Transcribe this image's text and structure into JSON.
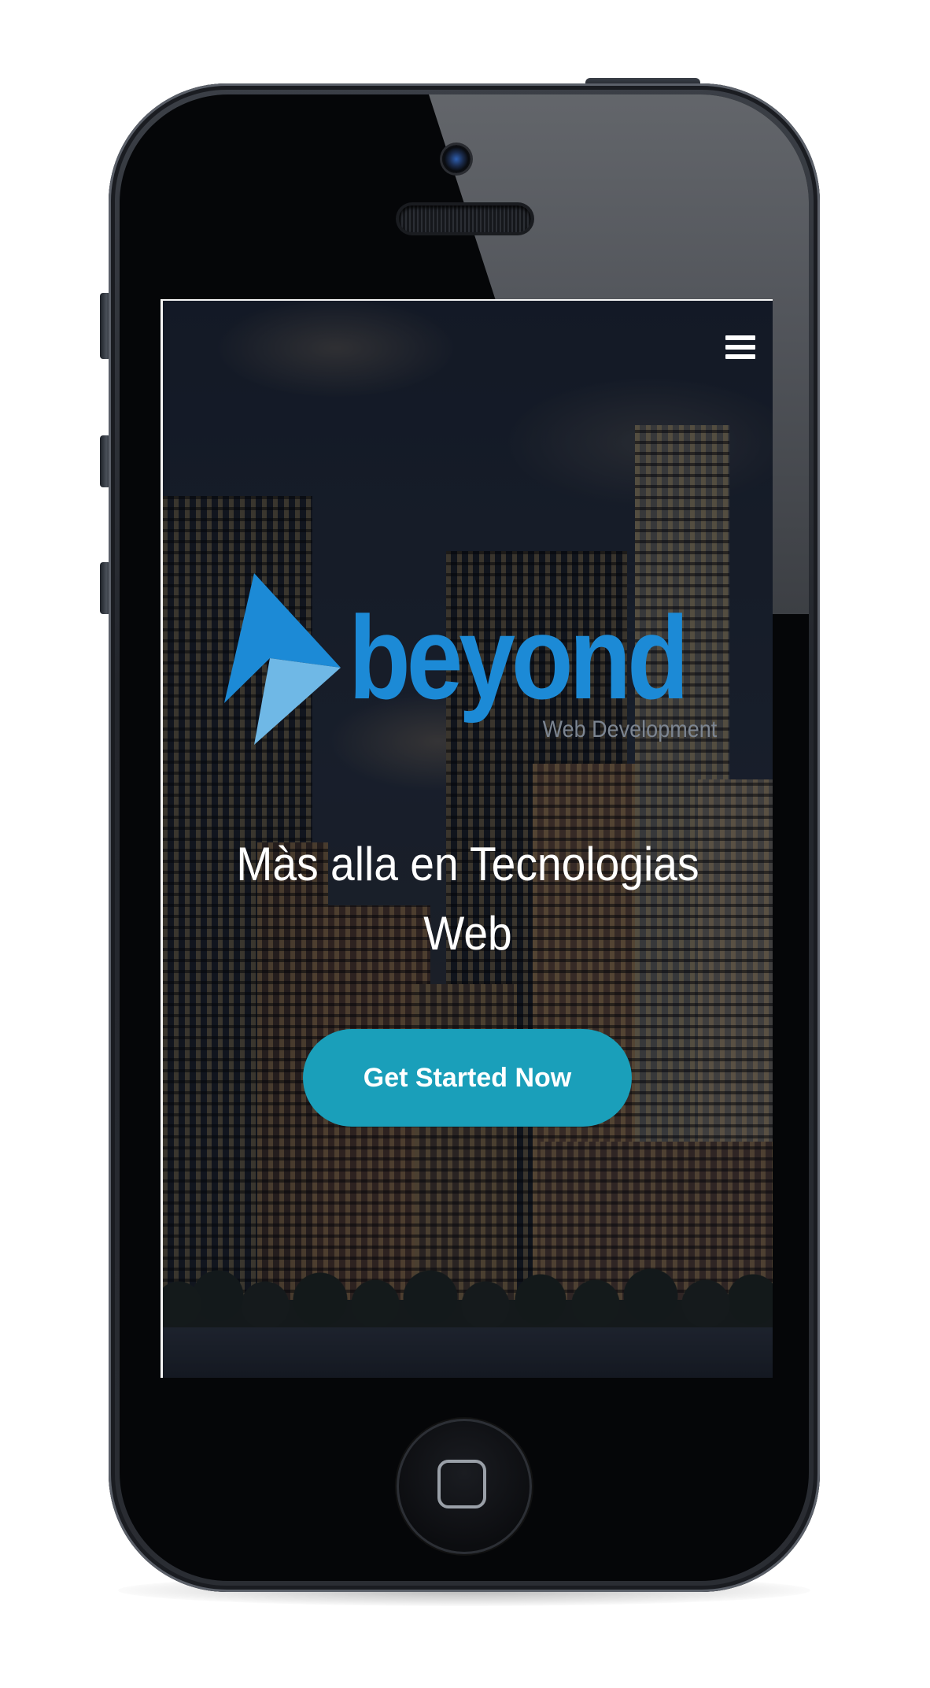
{
  "hero": {
    "logo": {
      "wordmark": "beyond",
      "tagline": "Web Development"
    },
    "headline_line1": "Màs alla en Tecnologias",
    "headline_line2": "Web",
    "cta_label": "Get Started Now"
  },
  "nav": {
    "menu_icon": "hamburger-menu-icon"
  },
  "colors": {
    "brand_blue": "#1c8ad6",
    "brand_light_blue": "#6fb8e6",
    "cta_teal": "#1a9fba",
    "text_white": "#ffffff",
    "tagline_gray": "#7c8591"
  },
  "device": {
    "home_button_icon": "home-square-icon"
  }
}
